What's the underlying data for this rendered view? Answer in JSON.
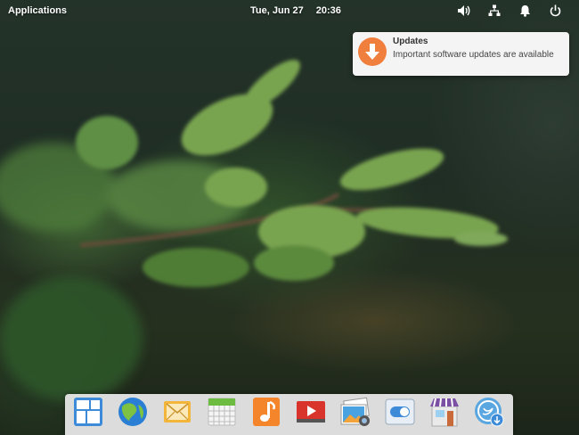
{
  "panel": {
    "applications_label": "Applications",
    "date": "Tue, Jun 27",
    "time": "20:36",
    "indicators": [
      "volume-icon",
      "network-icon",
      "notifications-icon",
      "power-icon"
    ]
  },
  "notification": {
    "title": "Updates",
    "body": "Important software updates are available",
    "icon": "download-arrow-icon",
    "accent": "#f07e3c"
  },
  "dock": {
    "apps": [
      "multitasking-view-icon",
      "web-browser-icon",
      "mail-icon",
      "calendar-icon",
      "music-icon",
      "videos-icon",
      "photos-icon",
      "system-settings-icon",
      "app-center-icon",
      "installer-icon"
    ]
  }
}
